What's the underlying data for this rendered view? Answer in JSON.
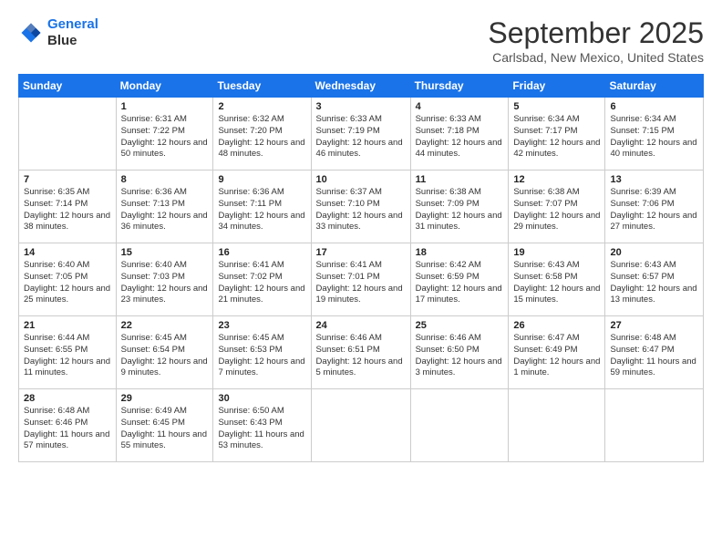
{
  "header": {
    "logo_line1": "General",
    "logo_line2": "Blue",
    "month": "September 2025",
    "location": "Carlsbad, New Mexico, United States"
  },
  "days_of_week": [
    "Sunday",
    "Monday",
    "Tuesday",
    "Wednesday",
    "Thursday",
    "Friday",
    "Saturday"
  ],
  "weeks": [
    [
      {
        "day": "",
        "sunrise": "",
        "sunset": "",
        "daylight": ""
      },
      {
        "day": "1",
        "sunrise": "Sunrise: 6:31 AM",
        "sunset": "Sunset: 7:22 PM",
        "daylight": "Daylight: 12 hours and 50 minutes."
      },
      {
        "day": "2",
        "sunrise": "Sunrise: 6:32 AM",
        "sunset": "Sunset: 7:20 PM",
        "daylight": "Daylight: 12 hours and 48 minutes."
      },
      {
        "day": "3",
        "sunrise": "Sunrise: 6:33 AM",
        "sunset": "Sunset: 7:19 PM",
        "daylight": "Daylight: 12 hours and 46 minutes."
      },
      {
        "day": "4",
        "sunrise": "Sunrise: 6:33 AM",
        "sunset": "Sunset: 7:18 PM",
        "daylight": "Daylight: 12 hours and 44 minutes."
      },
      {
        "day": "5",
        "sunrise": "Sunrise: 6:34 AM",
        "sunset": "Sunset: 7:17 PM",
        "daylight": "Daylight: 12 hours and 42 minutes."
      },
      {
        "day": "6",
        "sunrise": "Sunrise: 6:34 AM",
        "sunset": "Sunset: 7:15 PM",
        "daylight": "Daylight: 12 hours and 40 minutes."
      }
    ],
    [
      {
        "day": "7",
        "sunrise": "Sunrise: 6:35 AM",
        "sunset": "Sunset: 7:14 PM",
        "daylight": "Daylight: 12 hours and 38 minutes."
      },
      {
        "day": "8",
        "sunrise": "Sunrise: 6:36 AM",
        "sunset": "Sunset: 7:13 PM",
        "daylight": "Daylight: 12 hours and 36 minutes."
      },
      {
        "day": "9",
        "sunrise": "Sunrise: 6:36 AM",
        "sunset": "Sunset: 7:11 PM",
        "daylight": "Daylight: 12 hours and 34 minutes."
      },
      {
        "day": "10",
        "sunrise": "Sunrise: 6:37 AM",
        "sunset": "Sunset: 7:10 PM",
        "daylight": "Daylight: 12 hours and 33 minutes."
      },
      {
        "day": "11",
        "sunrise": "Sunrise: 6:38 AM",
        "sunset": "Sunset: 7:09 PM",
        "daylight": "Daylight: 12 hours and 31 minutes."
      },
      {
        "day": "12",
        "sunrise": "Sunrise: 6:38 AM",
        "sunset": "Sunset: 7:07 PM",
        "daylight": "Daylight: 12 hours and 29 minutes."
      },
      {
        "day": "13",
        "sunrise": "Sunrise: 6:39 AM",
        "sunset": "Sunset: 7:06 PM",
        "daylight": "Daylight: 12 hours and 27 minutes."
      }
    ],
    [
      {
        "day": "14",
        "sunrise": "Sunrise: 6:40 AM",
        "sunset": "Sunset: 7:05 PM",
        "daylight": "Daylight: 12 hours and 25 minutes."
      },
      {
        "day": "15",
        "sunrise": "Sunrise: 6:40 AM",
        "sunset": "Sunset: 7:03 PM",
        "daylight": "Daylight: 12 hours and 23 minutes."
      },
      {
        "day": "16",
        "sunrise": "Sunrise: 6:41 AM",
        "sunset": "Sunset: 7:02 PM",
        "daylight": "Daylight: 12 hours and 21 minutes."
      },
      {
        "day": "17",
        "sunrise": "Sunrise: 6:41 AM",
        "sunset": "Sunset: 7:01 PM",
        "daylight": "Daylight: 12 hours and 19 minutes."
      },
      {
        "day": "18",
        "sunrise": "Sunrise: 6:42 AM",
        "sunset": "Sunset: 6:59 PM",
        "daylight": "Daylight: 12 hours and 17 minutes."
      },
      {
        "day": "19",
        "sunrise": "Sunrise: 6:43 AM",
        "sunset": "Sunset: 6:58 PM",
        "daylight": "Daylight: 12 hours and 15 minutes."
      },
      {
        "day": "20",
        "sunrise": "Sunrise: 6:43 AM",
        "sunset": "Sunset: 6:57 PM",
        "daylight": "Daylight: 12 hours and 13 minutes."
      }
    ],
    [
      {
        "day": "21",
        "sunrise": "Sunrise: 6:44 AM",
        "sunset": "Sunset: 6:55 PM",
        "daylight": "Daylight: 12 hours and 11 minutes."
      },
      {
        "day": "22",
        "sunrise": "Sunrise: 6:45 AM",
        "sunset": "Sunset: 6:54 PM",
        "daylight": "Daylight: 12 hours and 9 minutes."
      },
      {
        "day": "23",
        "sunrise": "Sunrise: 6:45 AM",
        "sunset": "Sunset: 6:53 PM",
        "daylight": "Daylight: 12 hours and 7 minutes."
      },
      {
        "day": "24",
        "sunrise": "Sunrise: 6:46 AM",
        "sunset": "Sunset: 6:51 PM",
        "daylight": "Daylight: 12 hours and 5 minutes."
      },
      {
        "day": "25",
        "sunrise": "Sunrise: 6:46 AM",
        "sunset": "Sunset: 6:50 PM",
        "daylight": "Daylight: 12 hours and 3 minutes."
      },
      {
        "day": "26",
        "sunrise": "Sunrise: 6:47 AM",
        "sunset": "Sunset: 6:49 PM",
        "daylight": "Daylight: 12 hours and 1 minute."
      },
      {
        "day": "27",
        "sunrise": "Sunrise: 6:48 AM",
        "sunset": "Sunset: 6:47 PM",
        "daylight": "Daylight: 11 hours and 59 minutes."
      }
    ],
    [
      {
        "day": "28",
        "sunrise": "Sunrise: 6:48 AM",
        "sunset": "Sunset: 6:46 PM",
        "daylight": "Daylight: 11 hours and 57 minutes."
      },
      {
        "day": "29",
        "sunrise": "Sunrise: 6:49 AM",
        "sunset": "Sunset: 6:45 PM",
        "daylight": "Daylight: 11 hours and 55 minutes."
      },
      {
        "day": "30",
        "sunrise": "Sunrise: 6:50 AM",
        "sunset": "Sunset: 6:43 PM",
        "daylight": "Daylight: 11 hours and 53 minutes."
      },
      {
        "day": "",
        "sunrise": "",
        "sunset": "",
        "daylight": ""
      },
      {
        "day": "",
        "sunrise": "",
        "sunset": "",
        "daylight": ""
      },
      {
        "day": "",
        "sunrise": "",
        "sunset": "",
        "daylight": ""
      },
      {
        "day": "",
        "sunrise": "",
        "sunset": "",
        "daylight": ""
      }
    ]
  ]
}
